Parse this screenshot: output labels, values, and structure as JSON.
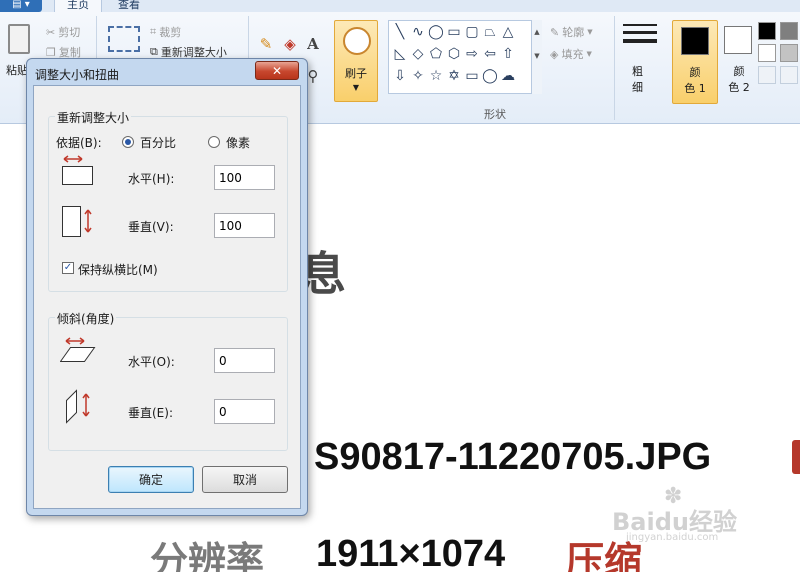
{
  "ribbon": {
    "file_menu_label": "▤ ▾",
    "tabs": [
      "主页",
      "查看"
    ],
    "clipboard": {
      "paste_label": "粘贴",
      "cut_label": "剪切",
      "copy_label": "复制"
    },
    "image": {
      "crop_label": "裁剪",
      "resize_label": "重新调整大小"
    },
    "brush_label": "刷子",
    "outline_label": "轮廓",
    "fill_label": "填充",
    "shapes_group_label": "形状",
    "size_label": "粗\n细",
    "color1_label": "颜\n色 1",
    "color2_label": "颜\n色 2",
    "colors": {
      "color1": "#000000",
      "color2": "#ffffff",
      "accent": "#f9cf6b"
    }
  },
  "background": {
    "partial_char": "息",
    "filename": "S90817-11220705.JPG",
    "resolution_label": "分辨率",
    "resolution_value": "1911×1074",
    "compress_label": "压缩",
    "watermark": "Baidu经验",
    "watermark_url": "jingyan.baidu.com"
  },
  "dialog": {
    "title": "调整大小和扭曲",
    "close_symbol": "✕",
    "resize": {
      "legend": "重新调整大小",
      "basis_label": "依据(B):",
      "percent_label": "百分比",
      "pixels_label": "像素",
      "horizontal_label": "水平(H):",
      "horizontal_value": "100",
      "vertical_label": "垂直(V):",
      "vertical_value": "100",
      "keep_ratio_label": "保持纵横比(M)",
      "keep_ratio_checked": true,
      "selected_basis": "percent"
    },
    "skew": {
      "legend": "倾斜(角度)",
      "horizontal_label": "水平(O):",
      "horizontal_value": "0",
      "vertical_label": "垂直(E):",
      "vertical_value": "0"
    },
    "ok_label": "确定",
    "cancel_label": "取消"
  }
}
